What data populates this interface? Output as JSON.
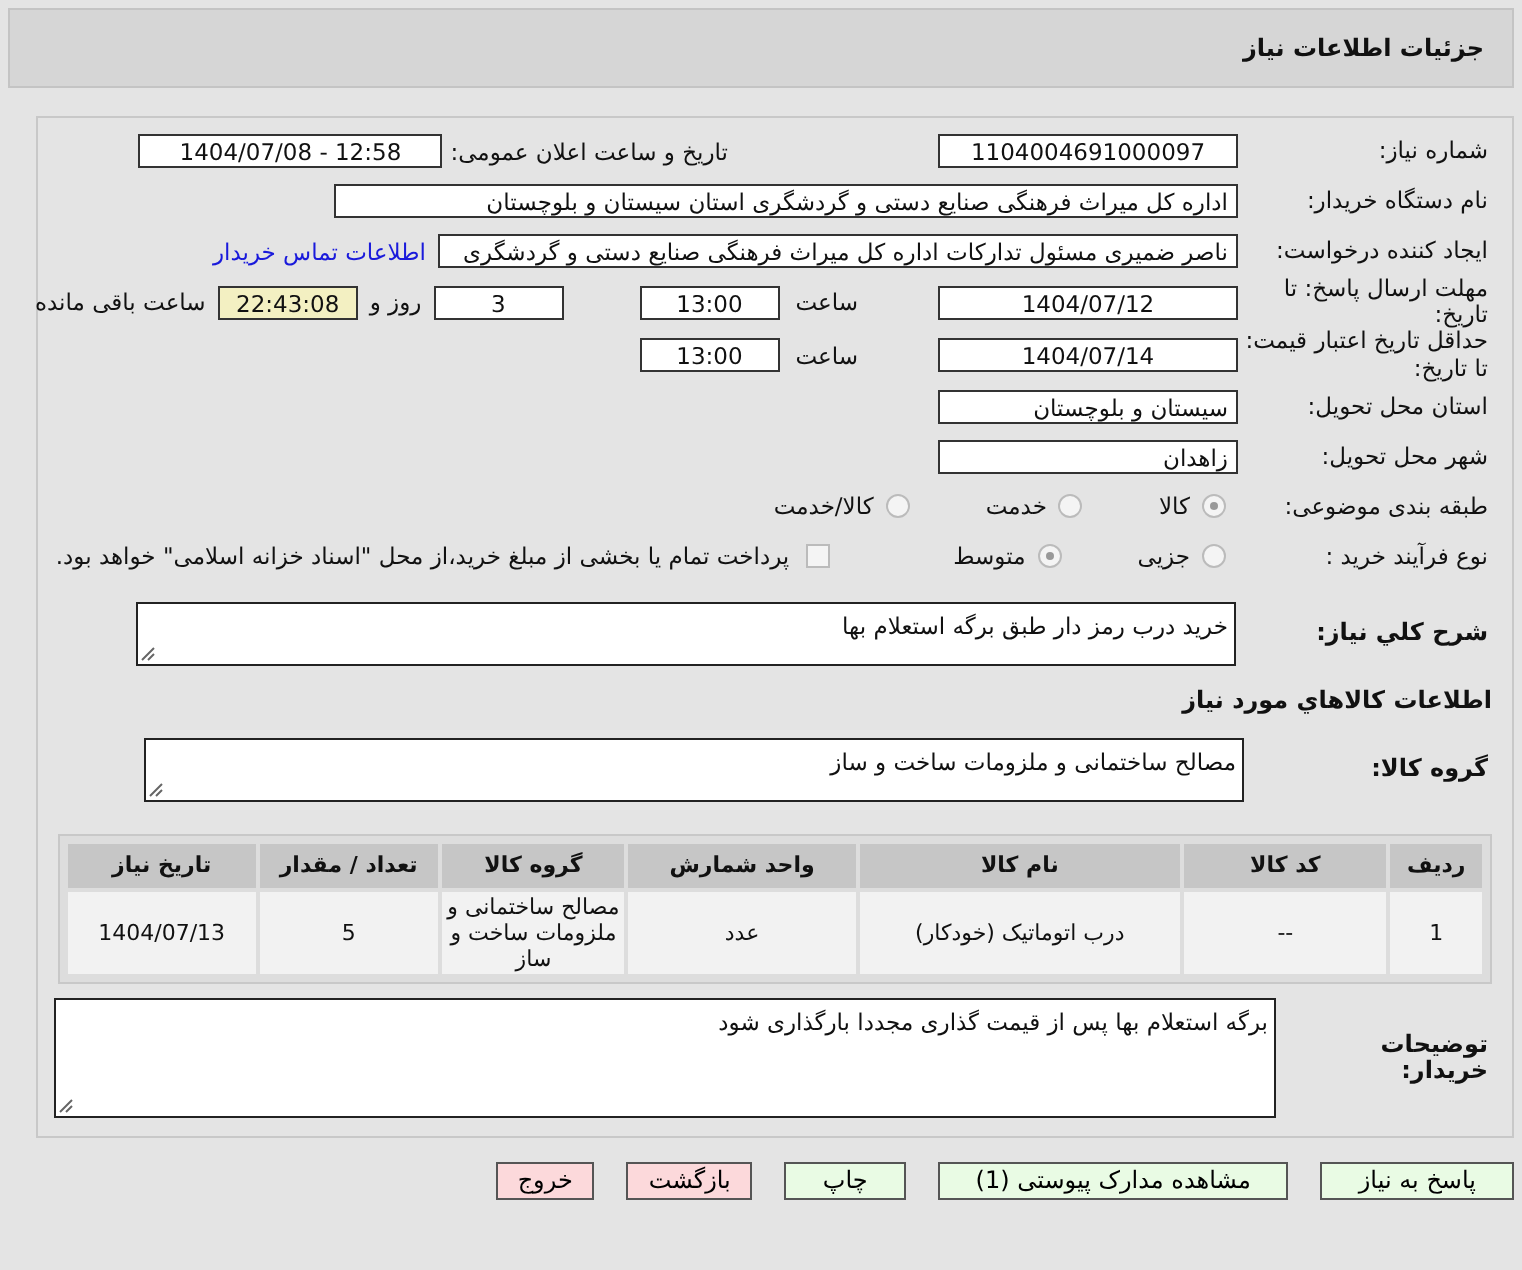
{
  "header": {
    "title": "جزئیات اطلاعات نیاز"
  },
  "need_number": {
    "label": "شماره نیاز:",
    "value": "1104004691000097"
  },
  "announce": {
    "label": "تاریخ و ساعت اعلان عمومی:",
    "value": "1404/07/08 - 12:58"
  },
  "buyer_org": {
    "label": "نام دستگاه خریدار:",
    "value": "اداره کل میراث فرهنگی  صنایع دستی و گردشگری استان سیستان و بلوچستان"
  },
  "requester": {
    "label": "ایجاد کننده درخواست:",
    "value": "ناصر ضمیری مسئول تدارکات اداره کل میراث فرهنگی  صنایع دستی و گردشگری",
    "link": "اطلاعات تماس خریدار"
  },
  "deadline": {
    "label": "مهلت ارسال پاسخ: تا تاریخ:",
    "date": "1404/07/12",
    "time_label": "ساعت",
    "time": "13:00",
    "days": "3",
    "days_label": "روز و",
    "remaining": "22:43:08",
    "remaining_label": "ساعت باقی مانده"
  },
  "validity": {
    "label": "حداقل تاریخ اعتبار قیمت: تا تاریخ:",
    "date": "1404/07/14",
    "time_label": "ساعت",
    "time": "13:00"
  },
  "province": {
    "label": "استان محل تحویل:",
    "value": "سیستان و بلوچستان"
  },
  "city": {
    "label": "شهر محل تحویل:",
    "value": "زاهدان"
  },
  "category": {
    "label": "طبقه بندی موضوعی:",
    "options": [
      {
        "label": "کالا",
        "selected": true
      },
      {
        "label": "خدمت",
        "selected": false
      },
      {
        "label": "کالا/خدمت",
        "selected": false
      }
    ]
  },
  "process": {
    "label": "نوع فرآیند خرید :",
    "options": [
      {
        "label": "جزیی",
        "selected": false
      },
      {
        "label": "متوسط",
        "selected": true
      }
    ],
    "payment": {
      "checked": false,
      "text": "پرداخت تمام یا بخشی از مبلغ خرید،از محل \"اسناد خزانه اسلامی\" خواهد بود."
    }
  },
  "description": {
    "label": "شرح کلي نياز:",
    "value": "خرید درب رمز دار طبق برگه استعلام بها"
  },
  "goods_heading": "اطلاعات کالاهاي مورد نياز",
  "goods_group": {
    "label": "گروه کالا:",
    "value": "مصالح ساختمانی و ملزومات ساخت و ساز"
  },
  "table": {
    "columns": [
      "ردیف",
      "کد کالا",
      "نام کالا",
      "واحد شمارش",
      "گروه کالا",
      "تعداد / مقدار",
      "تاریخ نیاز"
    ],
    "rows": [
      [
        "1",
        "--",
        "درب اتوماتیک (خودکار)",
        "عدد",
        "مصالح ساختمانی و ملزومات ساخت و ساز",
        "5",
        "1404/07/13"
      ]
    ]
  },
  "buyer_notes": {
    "label": "توضیحات خریدار:",
    "value": "برگه استعلام بها پس از قیمت گذاری مجددا بارگذاری شود"
  },
  "buttons": [
    {
      "label": "پاسخ به نیاز",
      "kind": "normal"
    },
    {
      "label": "مشاهده مدارک پیوستی (1)",
      "kind": "normal"
    },
    {
      "label": "چاپ",
      "kind": "normal"
    },
    {
      "label": "بازگشت",
      "kind": "exit"
    },
    {
      "label": "خروج",
      "kind": "exit"
    }
  ]
}
